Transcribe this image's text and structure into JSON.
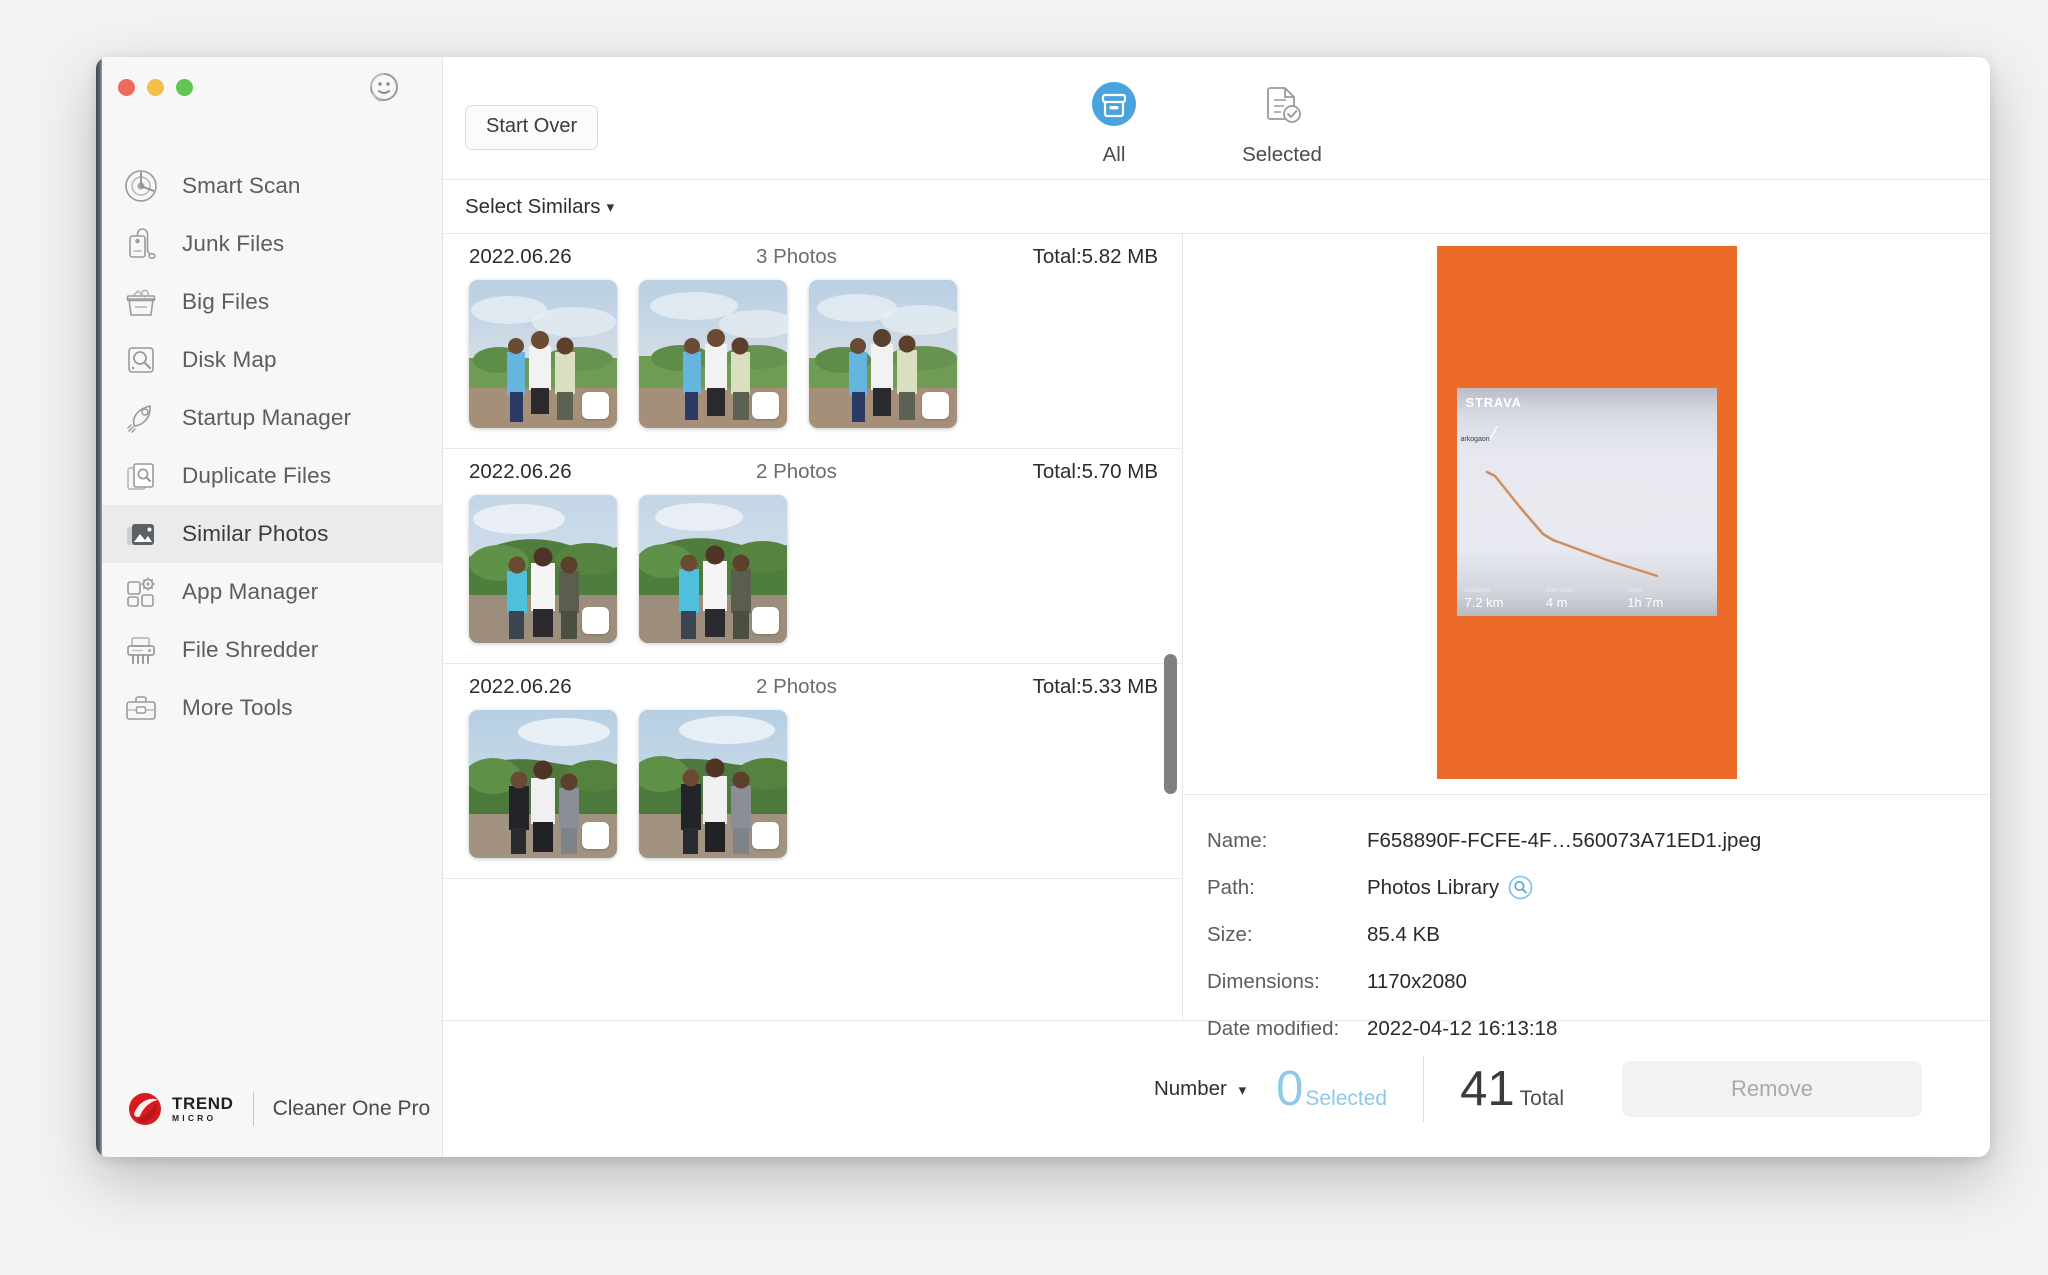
{
  "app": {
    "product_name": "Cleaner One Pro",
    "brand_top": "TREND",
    "brand_bottom": "MICRO"
  },
  "window_controls": {
    "close": "close",
    "minimize": "minimize",
    "maximize": "maximize",
    "support": "support-smiley"
  },
  "sidebar": {
    "items": [
      {
        "label": "Smart Scan",
        "icon": "radar-icon",
        "active": false
      },
      {
        "label": "Junk Files",
        "icon": "junk-bin-icon",
        "active": false
      },
      {
        "label": "Big Files",
        "icon": "big-files-box-icon",
        "active": false
      },
      {
        "label": "Disk Map",
        "icon": "disk-map-icon",
        "active": false
      },
      {
        "label": "Startup Manager",
        "icon": "rocket-icon",
        "active": false
      },
      {
        "label": "Duplicate Files",
        "icon": "duplicate-files-icon",
        "active": false
      },
      {
        "label": "Similar Photos",
        "icon": "similar-photos-icon",
        "active": true
      },
      {
        "label": "App Manager",
        "icon": "app-manager-icon",
        "active": false
      },
      {
        "label": "File Shredder",
        "icon": "shredder-icon",
        "active": false
      },
      {
        "label": "More Tools",
        "icon": "toolbox-icon",
        "active": false
      }
    ]
  },
  "toolbar": {
    "start_over_label": "Start Over",
    "tabs": [
      {
        "label": "All",
        "icon": "archive-box-icon",
        "active": true
      },
      {
        "label": "Selected",
        "icon": "document-check-icon",
        "active": false
      }
    ]
  },
  "subbar": {
    "select_similars_label": "Select Similars",
    "caret": "chevron-down-icon"
  },
  "groups": [
    {
      "date": "2022.06.26",
      "count": "3 Photos",
      "total": "Total:5.82 MB",
      "photos": [
        {
          "scene": "three-friends-cloudy-field",
          "checked": false
        },
        {
          "scene": "three-friends-cloudy-field",
          "checked": false
        },
        {
          "scene": "three-friends-cloudy-field",
          "checked": false
        }
      ]
    },
    {
      "date": "2022.06.26",
      "count": "2 Photos",
      "total": "Total:5.70 MB",
      "photos": [
        {
          "scene": "three-friends-green-hill",
          "checked": false
        },
        {
          "scene": "three-friends-green-hill",
          "checked": false
        }
      ]
    },
    {
      "date": "2022.06.26",
      "count": "2 Photos",
      "total": "Total:5.33 MB",
      "photos": [
        {
          "scene": "three-friends-dark-jackets",
          "checked": false
        },
        {
          "scene": "three-friends-dark-jackets",
          "checked": false
        }
      ]
    }
  ],
  "preview": {
    "image_kind": "strava-activity-screenshot",
    "background_color": "#ed6b28",
    "strava": {
      "logo": "STRAVA",
      "place_label": "arkogaon",
      "stats": [
        {
          "label": "Distance",
          "value": "7.2 km"
        },
        {
          "label": "Elev Gain",
          "value": "4 m"
        },
        {
          "label": "Time",
          "value": "1h 7m"
        }
      ]
    },
    "metadata": [
      {
        "label": "Name:",
        "value": "F658890F-FCFE-4F…560073A71ED1.jpeg",
        "icon": null
      },
      {
        "label": "Path:",
        "value": "Photos Library",
        "icon": "reveal-search-icon"
      },
      {
        "label": "Size:",
        "value": "85.4 KB",
        "icon": null
      },
      {
        "label": "Dimensions:",
        "value": "1170x2080",
        "icon": null
      },
      {
        "label": "Date modified:",
        "value": "2022-04-12 16:13:18",
        "icon": null
      }
    ]
  },
  "bottom": {
    "number_label": "Number",
    "selected_count": "0",
    "selected_label": "Selected",
    "total_count": "41",
    "total_label": "Total",
    "remove_label": "Remove"
  },
  "colors": {
    "accent_blue": "#49a3dd",
    "selected_blue": "#8ec9e8",
    "brand_red": "#d71920",
    "preview_orange": "#ed6b28"
  }
}
